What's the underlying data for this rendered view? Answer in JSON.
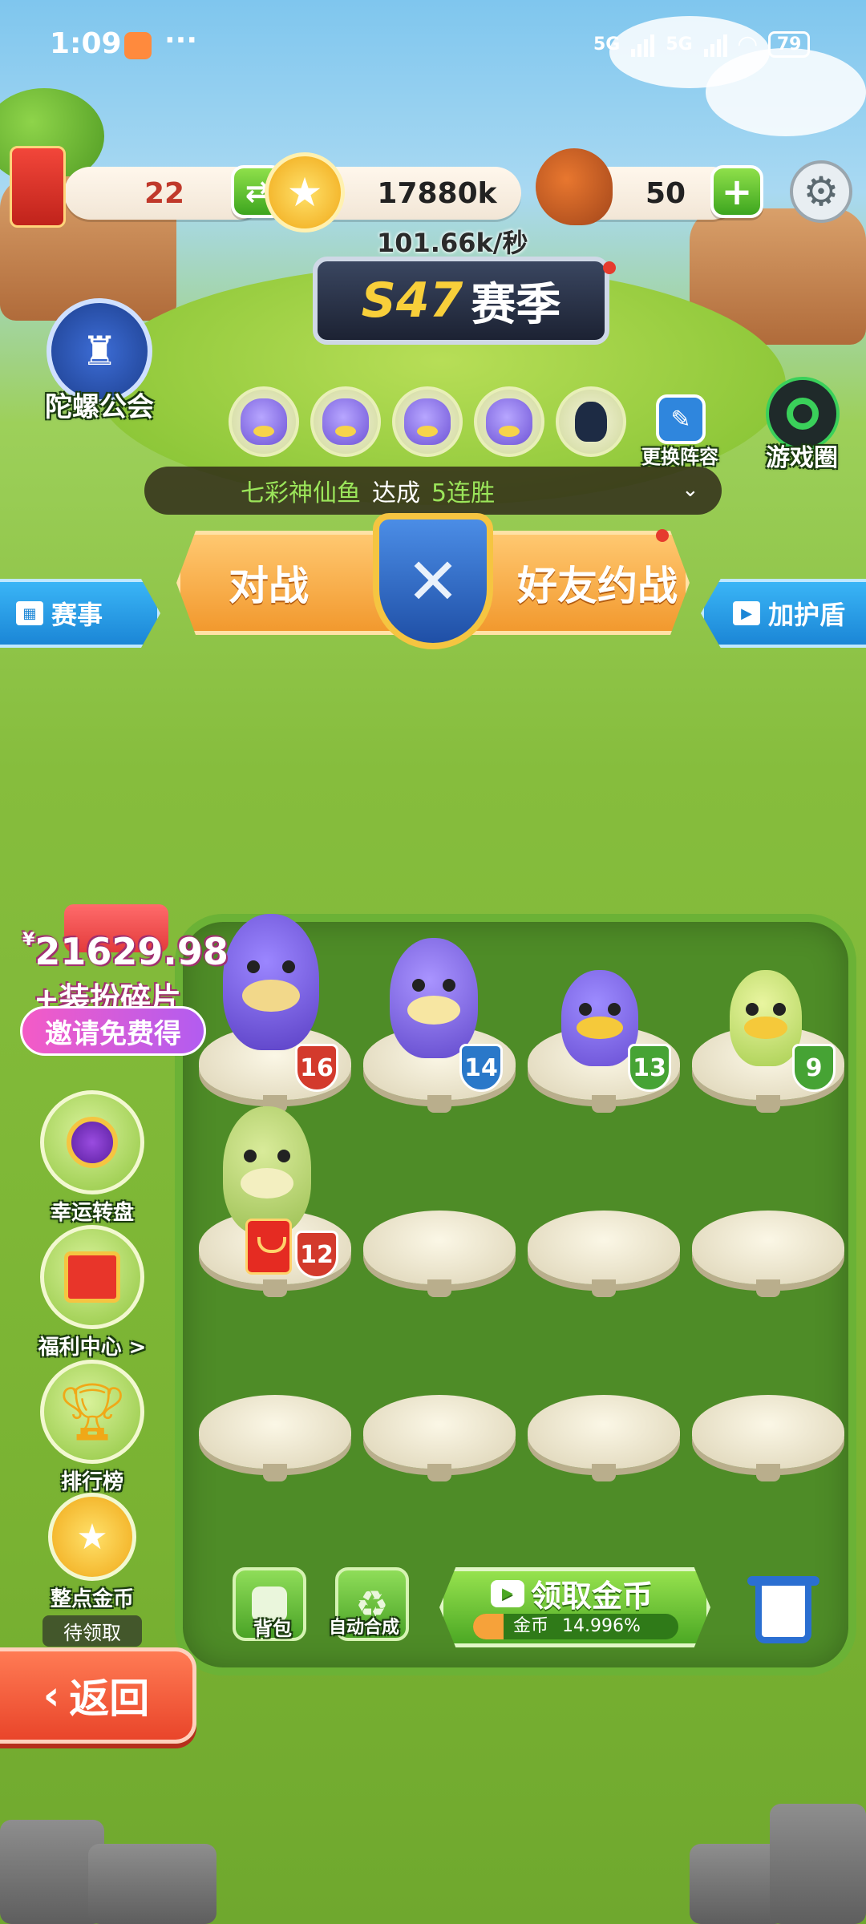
{
  "status_bar": {
    "time": "1:09",
    "dots": "···",
    "net1": "5G",
    "net2": "5G",
    "battery": "79"
  },
  "resources": {
    "red_packet_count": "22",
    "coins": "17880k",
    "meat": "50",
    "coin_rate": "101.66k/秒"
  },
  "season": {
    "code": "S47",
    "label": "赛季"
  },
  "guild": {
    "label": "陀螺公会"
  },
  "lineup": {
    "change_label": "更换阵容",
    "game_circle_label": "游戏圈"
  },
  "target": {
    "pet": "七彩神仙鱼",
    "text": "达成",
    "goal": "5连胜"
  },
  "battle": {
    "left": "对战",
    "right": "好友约战"
  },
  "side_tabs": {
    "events": "赛事",
    "shield": "加护盾"
  },
  "promo": {
    "currency": "¥",
    "amount": "21629.98",
    "sub": "+装扮碎片",
    "button": "邀请免费得"
  },
  "menu": {
    "lucky_wheel": "幸运转盘",
    "welfare": "福利中心 >",
    "ranking": "排行榜",
    "hourly_coins": "整点金币",
    "hourly_status": "待领取"
  },
  "board": {
    "levels": [
      "16",
      "14",
      "13",
      "9",
      "12"
    ]
  },
  "bottom": {
    "backpack": "背包",
    "auto_merge": "自动合成",
    "collect_title": "领取金币",
    "collect_progress_label": "金币",
    "collect_progress_value": "14.996%",
    "collect_progress_fraction": 0.14996,
    "back": "返回"
  },
  "colors": {
    "accent_orange": "#f2992e",
    "accent_green": "#4aa326",
    "accent_blue": "#1b86d6"
  }
}
